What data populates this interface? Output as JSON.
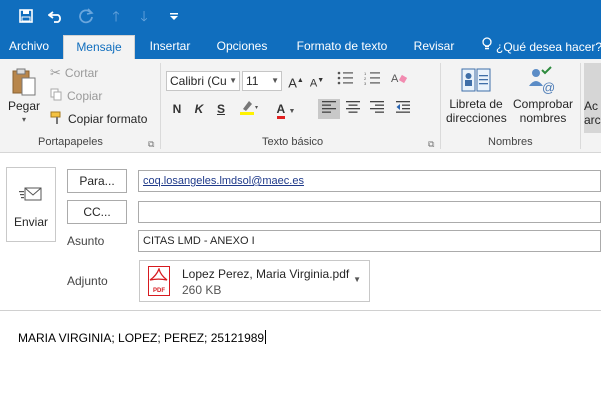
{
  "quick_access": {
    "save_icon": "save-icon",
    "undo_icon": "undo-icon",
    "redo_icon": "redo-icon",
    "up_icon": "up-arrow-icon",
    "down_icon": "down-arrow-icon",
    "customize_icon": "customize-icon"
  },
  "tabs": [
    {
      "label": "Archivo"
    },
    {
      "label": "Mensaje"
    },
    {
      "label": "Insertar"
    },
    {
      "label": "Opciones"
    },
    {
      "label": "Formato de texto"
    },
    {
      "label": "Revisar"
    }
  ],
  "active_tab": "Mensaje",
  "tell_me": {
    "label": "¿Qué desea hacer?"
  },
  "ribbon": {
    "portapapeles": {
      "paste_label": "Pegar",
      "cut_label": "Cortar",
      "copy_label": "Copiar",
      "format_painter_label": "Copiar formato",
      "group_label": "Portapapeles"
    },
    "texto_basico": {
      "font_name": "Calibri (Cu",
      "font_size": "11",
      "bold": "N",
      "italic": "K",
      "underline": "S",
      "font_color_glyph": "A",
      "group_label": "Texto básico"
    },
    "nombres": {
      "address_book_line1": "Libreta de",
      "address_book_line2": "direcciones",
      "check_names_line1": "Comprobar",
      "check_names_line2": "nombres",
      "group_label": "Nombres"
    },
    "cut_off_line1": "Ac",
    "cut_off_line2": "arc"
  },
  "compose": {
    "send_label": "Enviar",
    "to_button": "Para...",
    "to_value": "coq.losangeles.lmdsol@maec.es",
    "cc_button": "CC...",
    "cc_value": "",
    "subject_label": "Asunto",
    "subject_value": "CITAS LMD - ANEXO I",
    "attachment_label": "Adjunto",
    "attachment": {
      "name": "Lopez Perez, Maria Virginia.pdf",
      "size": "260 KB",
      "type_badge": "PDF"
    },
    "body_text": "MARIA VIRGINIA; LOPEZ; PEREZ; 25121989"
  },
  "colors": {
    "accent": "#106ebe",
    "ribbon_bg": "#f3f3f3",
    "pdf_red": "#d71a1f",
    "highlight_yellow": "#fff200",
    "font_color_red": "#e02020"
  }
}
